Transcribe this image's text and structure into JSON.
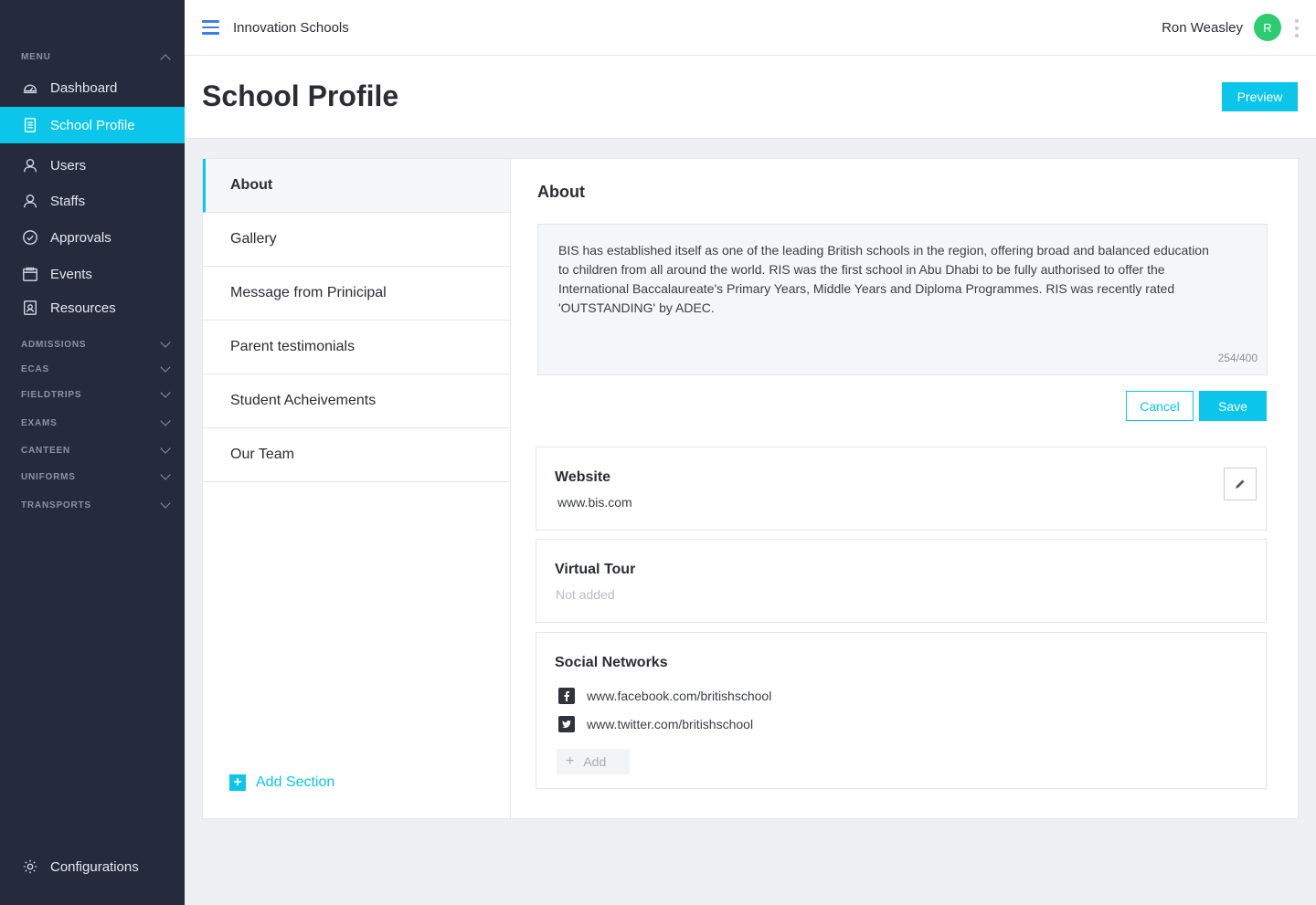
{
  "sidebar": {
    "menu_label": "MENU",
    "items": [
      {
        "label": "Dashboard",
        "icon": "dashboard-icon"
      },
      {
        "label": "School Profile",
        "icon": "school-profile-icon"
      },
      {
        "label": "Users",
        "icon": "user-icon"
      },
      {
        "label": "Staffs",
        "icon": "staff-icon"
      },
      {
        "label": "Approvals",
        "icon": "check-circle-icon"
      },
      {
        "label": "Events",
        "icon": "calendar-icon"
      },
      {
        "label": "Resources",
        "icon": "resources-icon"
      }
    ],
    "active_item": "School Profile",
    "groups": [
      "ADMISSIONS",
      "ECAS",
      "FIELDTRIPS",
      "EXAMS",
      "CANTEEN",
      "UNIFORMS",
      "TRANSPORTS"
    ],
    "footer_item": {
      "label": "Configurations",
      "icon": "gear-icon"
    }
  },
  "topbar": {
    "brand": "Innovation Schools",
    "user_name": "Ron Weasley",
    "avatar_initial": "R",
    "avatar_color": "#2ecc71"
  },
  "header": {
    "title": "School Profile",
    "preview_label": "Preview"
  },
  "sections": {
    "items": [
      "About",
      "Gallery",
      "Message from Prinicipal",
      "Parent testimonials",
      "Student Acheivements",
      "Our Team"
    ],
    "active": "About",
    "add_label": "Add Section"
  },
  "about": {
    "title": "About",
    "text": "BIS has established itself as one of the leading British schools in the region, offering broad and balanced education to children from all around the world.  RIS was the first school in Abu Dhabi to be fully authorised to offer the International Baccalaureate's Primary Years, Middle Years and Diploma Programmes. RIS was recently rated 'OUTSTANDING' by ADEC.",
    "counter": "254/400",
    "cancel_label": "Cancel",
    "save_label": "Save"
  },
  "website": {
    "title": "Website",
    "value": "www.bis.com"
  },
  "virtual_tour": {
    "title": "Virtual Tour",
    "value": "Not added"
  },
  "social": {
    "title": "Social Networks",
    "links": [
      {
        "network": "facebook",
        "icon": "facebook-icon",
        "url": "www.facebook.com/britishschool"
      },
      {
        "network": "twitter",
        "icon": "twitter-icon",
        "url": "www.twitter.com/britishschool"
      }
    ],
    "add_label": "Add"
  },
  "colors": {
    "accent": "#0bc6ea",
    "sidebar_bg": "#252a3d",
    "hamburger": "#3d7de8"
  }
}
